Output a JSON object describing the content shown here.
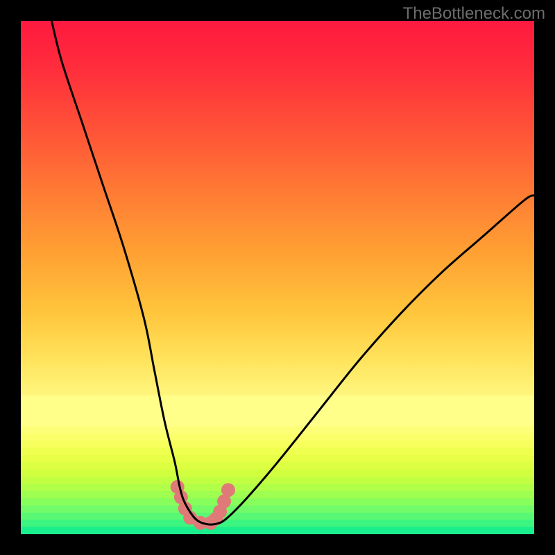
{
  "watermark": "TheBottleneck.com",
  "chart_data": {
    "type": "line",
    "title": "",
    "xlabel": "",
    "ylabel": "",
    "xlim": [
      0,
      100
    ],
    "ylim": [
      0,
      100
    ],
    "series": [
      {
        "name": "bottleneck-curve",
        "x": [
          6,
          8,
          12,
          16,
          20,
          24,
          26,
          28,
          30,
          31,
          32,
          34,
          36,
          38,
          40,
          44,
          50,
          58,
          66,
          74,
          82,
          90,
          98,
          100
        ],
        "y": [
          100,
          92,
          80,
          68,
          56,
          42,
          32,
          22,
          14,
          9,
          6,
          3,
          2,
          2,
          3,
          7,
          14,
          24,
          34,
          43,
          51,
          58,
          65,
          66
        ]
      }
    ],
    "markers": {
      "name": "highlight-band",
      "x": [
        30.5,
        31.2,
        32,
        33,
        35,
        37,
        38,
        38.8,
        39.6,
        40.4
      ],
      "y": [
        9.2,
        7.2,
        5.0,
        3.2,
        2.2,
        2.2,
        3.0,
        4.4,
        6.4,
        8.6
      ],
      "color": "#e07a78",
      "radius": 10
    },
    "gradient_bands": [
      {
        "y_from": 100,
        "y_to": 27,
        "gradient": "red-orange-yellow"
      },
      {
        "y_from": 27,
        "y_to": 21,
        "color": "#ffff8a"
      },
      {
        "y_from": 21,
        "y_to": 19.6,
        "color": "#feff79"
      },
      {
        "y_from": 19.6,
        "y_to": 18.2,
        "color": "#fbff6a"
      },
      {
        "y_from": 18.2,
        "y_to": 16.8,
        "color": "#f6ff5b"
      },
      {
        "y_from": 16.8,
        "y_to": 15.4,
        "color": "#efff4f"
      },
      {
        "y_from": 15.4,
        "y_to": 14.0,
        "color": "#e7ff46"
      },
      {
        "y_from": 14.0,
        "y_to": 12.6,
        "color": "#ddff41"
      },
      {
        "y_from": 12.6,
        "y_to": 11.2,
        "color": "#d1ff3f"
      },
      {
        "y_from": 11.2,
        "y_to": 9.8,
        "color": "#c2ff42"
      },
      {
        "y_from": 9.8,
        "y_to": 8.4,
        "color": "#b1ff48"
      },
      {
        "y_from": 8.4,
        "y_to": 7.0,
        "color": "#9eff51"
      },
      {
        "y_from": 7.0,
        "y_to": 5.6,
        "color": "#88fe5c"
      },
      {
        "y_from": 5.6,
        "y_to": 4.2,
        "color": "#71fb68"
      },
      {
        "y_from": 4.2,
        "y_to": 2.8,
        "color": "#58f874"
      },
      {
        "y_from": 2.8,
        "y_to": 1.4,
        "color": "#3cf480"
      },
      {
        "y_from": 1.4,
        "y_to": 0.0,
        "color": "#19ef8c"
      }
    ]
  }
}
